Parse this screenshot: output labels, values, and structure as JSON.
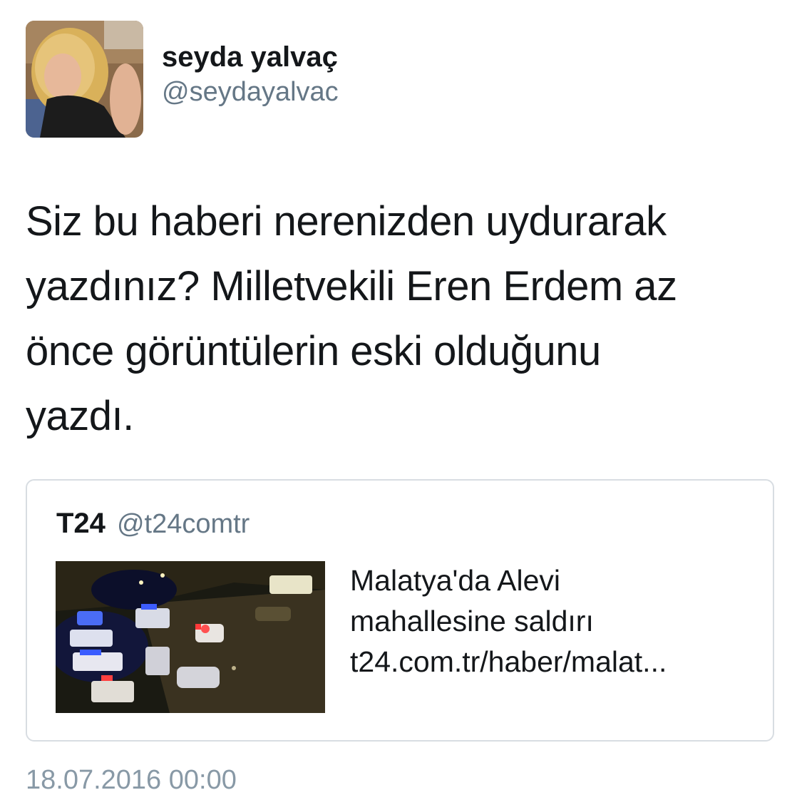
{
  "tweet": {
    "author_name": "seyda yalvaç",
    "author_handle": "@seydayalvac",
    "text": "Siz bu haberi nerenizden uydurarak\nyazdınız? Milletvekili Eren Erdem az\nönce görüntülerin eski olduğunu\nyazdı.",
    "timestamp": "18.07.2016 00:00"
  },
  "quoted": {
    "name": "T24",
    "handle": "@t24comtr",
    "title_line1": "Malatya'da Alevi",
    "title_line2": "mahallesine saldırı",
    "link": "t24.com.tr/haber/malat..."
  },
  "colors": {
    "text": "#14171a",
    "secondary": "#657786",
    "border": "#d8dde2"
  },
  "icons": {
    "avatar": "profile-photo",
    "thumbnail": "news-photo-night-street-police-cars"
  }
}
